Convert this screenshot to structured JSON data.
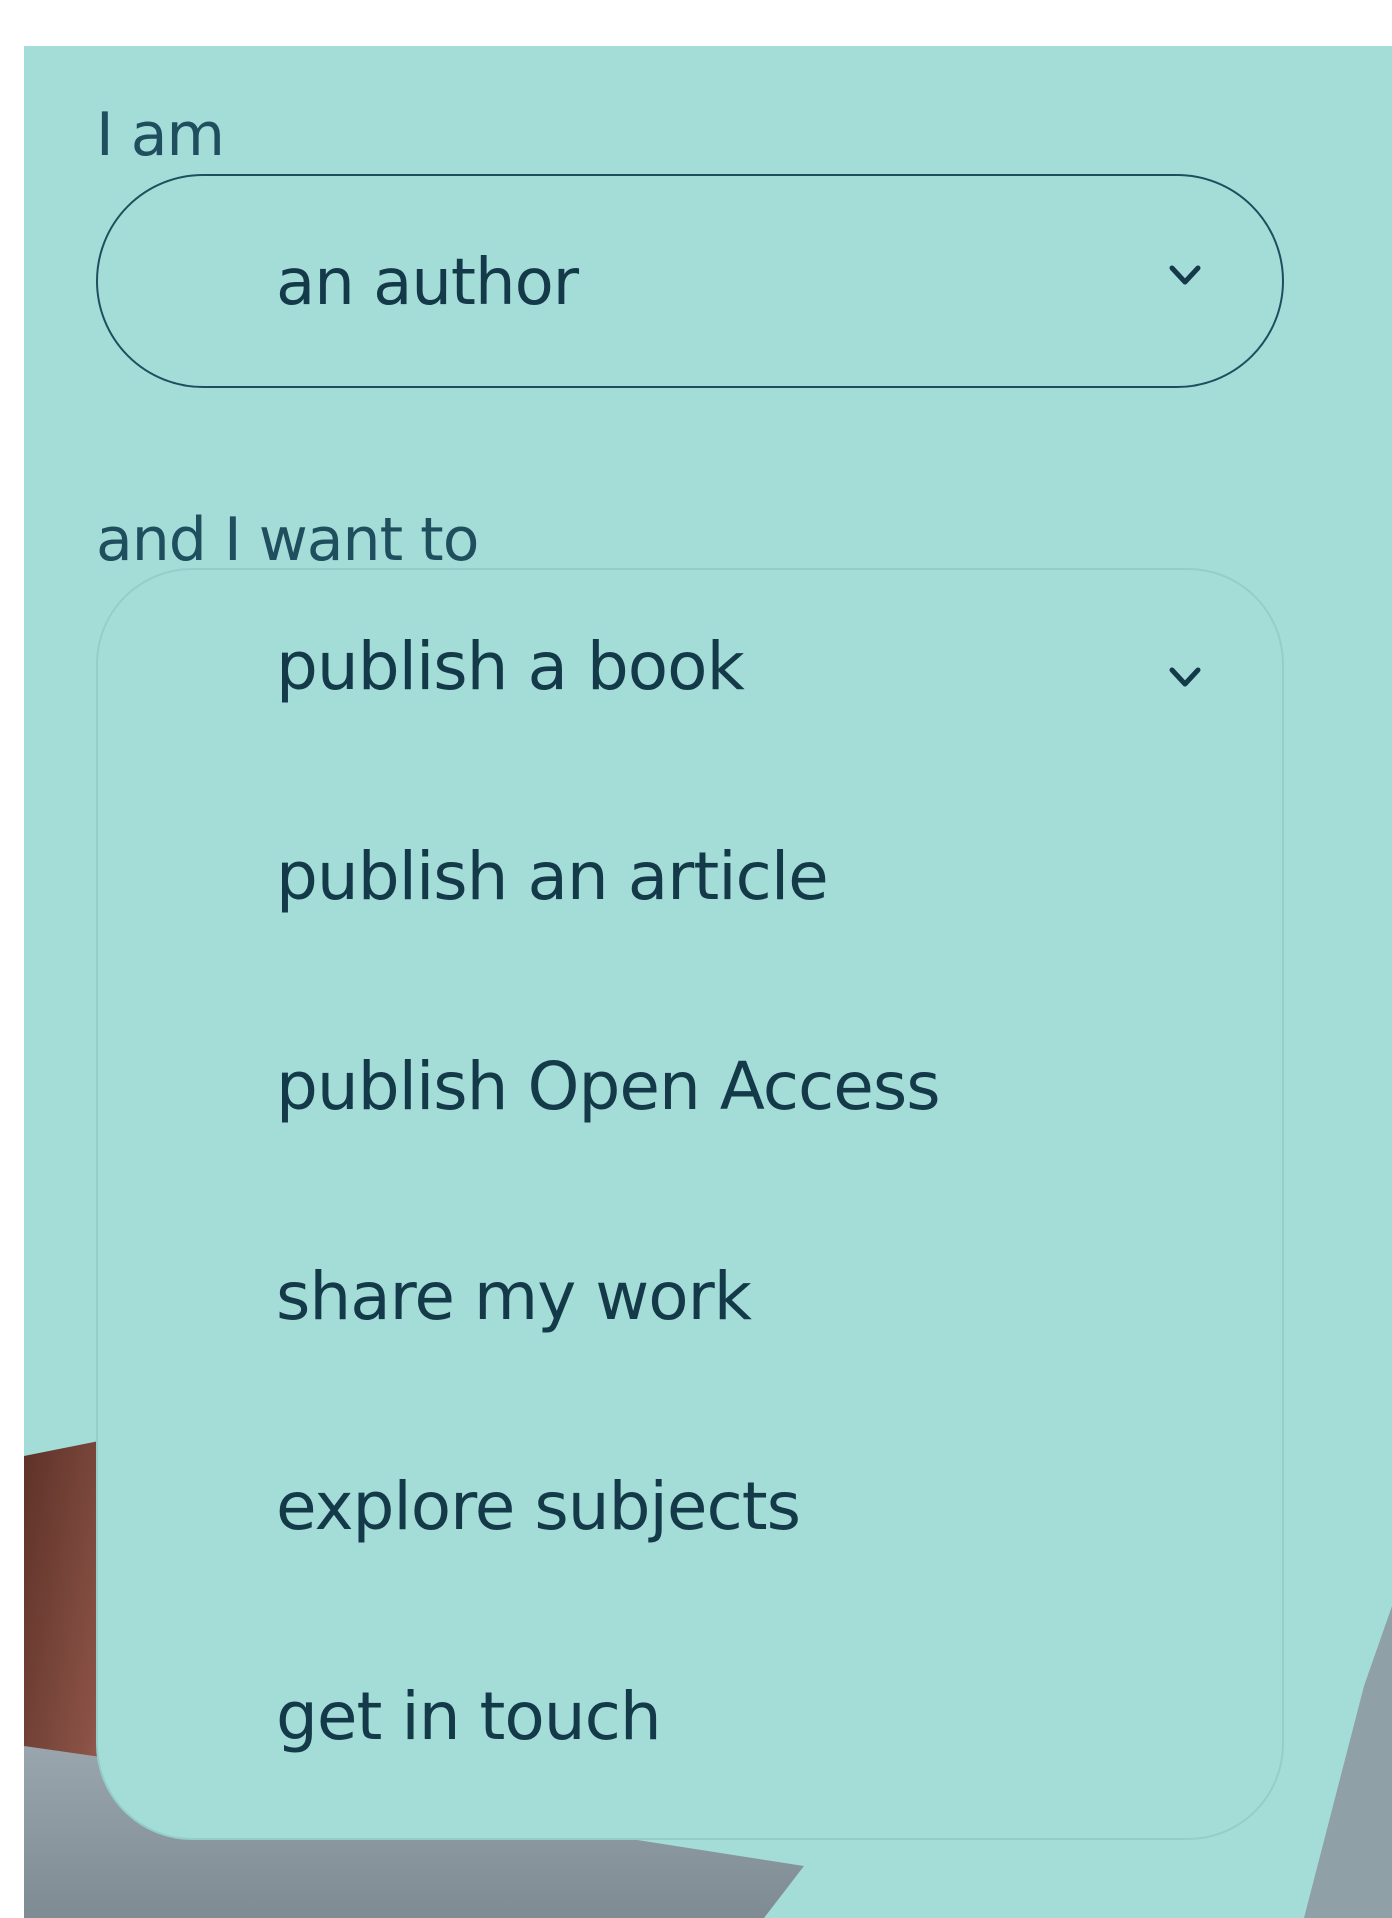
{
  "form": {
    "role_label": "I am",
    "role_selected": "an author",
    "intent_label": "and I want to",
    "intent_options": [
      "publish a book",
      "publish an article",
      "publish Open Access",
      "share my work",
      "explore subjects",
      "get in touch"
    ]
  },
  "icons": {
    "role_chevron": "chevron-down-icon",
    "intent_chevron": "chevron-down-icon"
  },
  "colors": {
    "panel_bg": "#a4ddd8",
    "text": "#143a4a",
    "border": "#1f4f5e"
  }
}
